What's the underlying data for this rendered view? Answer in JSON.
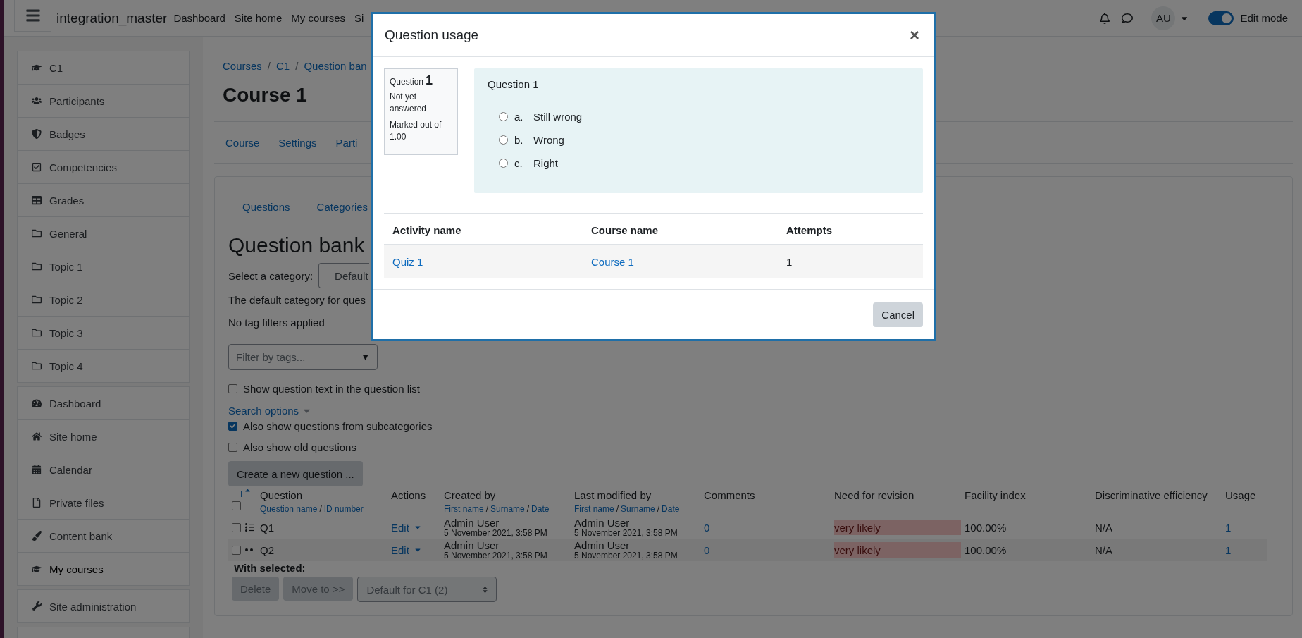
{
  "navbar": {
    "site_name": "integration_master",
    "links": [
      "Dashboard",
      "Site home",
      "My courses",
      "Si"
    ],
    "avatar": "AU",
    "edit_mode": {
      "label": "Edit mode",
      "on": true
    }
  },
  "sidebar": {
    "groups": [
      {
        "items": [
          {
            "label": "C1",
            "kind": "course",
            "selected": false
          },
          {
            "label": "Participants",
            "kind": "participants",
            "selected": false
          },
          {
            "label": "Badges",
            "kind": "badges",
            "selected": false
          },
          {
            "label": "Competencies",
            "kind": "competencies",
            "selected": false
          },
          {
            "label": "Grades",
            "kind": "grades",
            "selected": false
          },
          {
            "label": "General",
            "kind": "section",
            "selected": false
          },
          {
            "label": "Topic 1",
            "kind": "section",
            "selected": false
          },
          {
            "label": "Topic 2",
            "kind": "section",
            "selected": false
          },
          {
            "label": "Topic 3",
            "kind": "section",
            "selected": false
          },
          {
            "label": "Topic 4",
            "kind": "section",
            "selected": false
          }
        ]
      },
      {
        "items": [
          {
            "label": "Dashboard",
            "kind": "dashboard",
            "selected": false
          },
          {
            "label": "Site home",
            "kind": "home",
            "selected": false
          },
          {
            "label": "Calendar",
            "kind": "calendar",
            "selected": false
          },
          {
            "label": "Private files",
            "kind": "files",
            "selected": false
          },
          {
            "label": "Content bank",
            "kind": "contentbank",
            "selected": false
          },
          {
            "label": "My courses",
            "kind": "course",
            "selected": true
          }
        ]
      },
      {
        "items": [
          {
            "label": "Site administration",
            "kind": "admin",
            "selected": false
          }
        ]
      }
    ]
  },
  "breadcrumb": {
    "items": [
      "Courses",
      "C1",
      "Question ban"
    ],
    "separator": "/"
  },
  "title": "Course 1",
  "course_tabs": [
    "Course",
    "Settings",
    "Parti"
  ],
  "bank_tabs": [
    "Questions",
    "Categories"
  ],
  "heading": "Question bank",
  "category": {
    "label": "Select a category:",
    "value": "Default"
  },
  "notes": [
    "The default category for ques",
    "No tag filters applied"
  ],
  "tag_filter": {
    "placeholder": "Filter by tags...",
    "caret": "▼"
  },
  "options_top": [
    {
      "label": "Show question text in the question list",
      "checked": false
    }
  ],
  "search_options": "Search options",
  "options": [
    {
      "label": "Also show questions from subcategories",
      "checked": true
    },
    {
      "label": "Also show old questions",
      "checked": false
    }
  ],
  "create_button": "Create a new question ...",
  "table": {
    "sort_mark": "T",
    "select_all_checked": false,
    "separator": "/",
    "columns": [
      {
        "label": "Question",
        "sublinks": [
          "Question name",
          "ID number"
        ]
      },
      {
        "label": "Actions"
      },
      {
        "label": "Created by",
        "sublinks": [
          "First name",
          "Surname",
          "Date"
        ]
      },
      {
        "label": "Last modified by",
        "sublinks": [
          "First name",
          "Surname",
          "Date"
        ]
      },
      {
        "label": "Comments"
      },
      {
        "label": "Need for revision"
      },
      {
        "label": "Facility index"
      },
      {
        "label": "Discriminative efficiency"
      },
      {
        "label": "Usage"
      }
    ],
    "rows": [
      {
        "kind": "multichoice",
        "checked": false,
        "name": "Q1",
        "action": "Edit",
        "created": {
          "name": "Admin User",
          "date": "5 November 2021, 3:58 PM"
        },
        "modified": {
          "name": "Admin User",
          "date": "5 November 2021, 3:58 PM"
        },
        "comments": "0",
        "revision": "very likely",
        "facility": "100.00%",
        "discrimination": "N/A",
        "usage": "1"
      },
      {
        "kind": "truefalse",
        "checked": false,
        "name": "Q2",
        "action": "Edit",
        "created": {
          "name": "Admin User",
          "date": "5 November 2021, 3:58 PM"
        },
        "modified": {
          "name": "Admin User",
          "date": "5 November 2021, 3:58 PM"
        },
        "comments": "0",
        "revision": "very likely",
        "facility": "100.00%",
        "discrimination": "N/A",
        "usage": "1"
      }
    ]
  },
  "with_selected": {
    "label": "With selected:",
    "buttons": [
      {
        "label": "Delete",
        "disabled": true
      },
      {
        "label": "Move to >>",
        "disabled": true
      }
    ],
    "target": {
      "value": "Default for C1 (2)",
      "disabled": true
    }
  },
  "modal": {
    "title": "Question usage",
    "close": "×",
    "info": {
      "label": "Question",
      "number": "1",
      "state": "Not yet answered",
      "mark": "Marked out of 1.00"
    },
    "question": {
      "text": "Question 1",
      "options": [
        {
          "letter": "a.",
          "text": "Still wrong",
          "selected": false
        },
        {
          "letter": "b.",
          "text": "Wrong",
          "selected": false
        },
        {
          "letter": "c.",
          "text": "Right",
          "selected": false
        }
      ]
    },
    "usage_table": {
      "columns": [
        "Activity name",
        "Course name",
        "Attempts"
      ],
      "rows": [
        {
          "activity": "Quiz 1",
          "course": "Course 1",
          "attempts": "1"
        }
      ]
    },
    "cancel": "Cancel"
  }
}
